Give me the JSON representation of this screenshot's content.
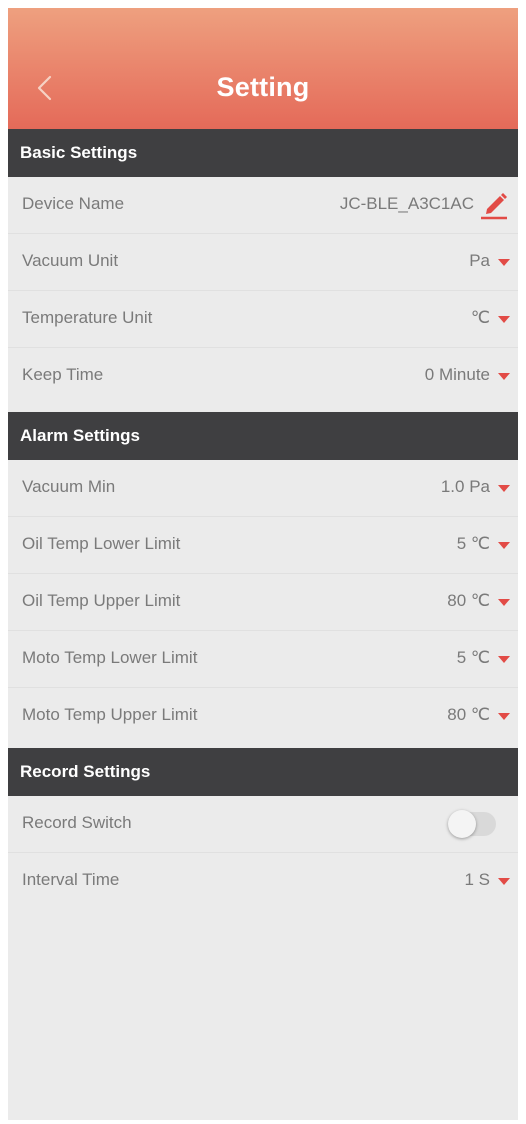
{
  "header": {
    "title": "Setting",
    "back_icon": "chevron-left-icon"
  },
  "sections": {
    "basic": {
      "title": "Basic Settings",
      "device_name": {
        "label": "Device Name",
        "value": "JC-BLE_A3C1AC"
      },
      "vacuum_unit": {
        "label": "Vacuum Unit",
        "value": "Pa"
      },
      "temperature_unit": {
        "label": "Temperature Unit",
        "value": "℃"
      },
      "keep_time": {
        "label": "Keep Time",
        "value": "0 Minute"
      }
    },
    "alarm": {
      "title": "Alarm Settings",
      "vacuum_min": {
        "label": "Vacuum Min",
        "value": "1.0 Pa"
      },
      "oil_temp_lower": {
        "label": "Oil Temp Lower Limit",
        "value": "5 ℃"
      },
      "oil_temp_upper": {
        "label": "Oil Temp Upper Limit",
        "value": "80 ℃"
      },
      "moto_temp_lower": {
        "label": "Moto Temp Lower Limit",
        "value": "5 ℃"
      },
      "moto_temp_upper": {
        "label": "Moto Temp Upper Limit",
        "value": "80 ℃"
      }
    },
    "record": {
      "title": "Record Settings",
      "record_switch": {
        "label": "Record Switch",
        "on": false
      },
      "interval_time": {
        "label": "Interval Time",
        "value": "1 S"
      }
    }
  },
  "colors": {
    "header_top": "#eea07f",
    "header_bottom": "#e46a59",
    "section_bg": "#3f3f41",
    "accent": "#e24b46",
    "background": "#ebebeb"
  }
}
